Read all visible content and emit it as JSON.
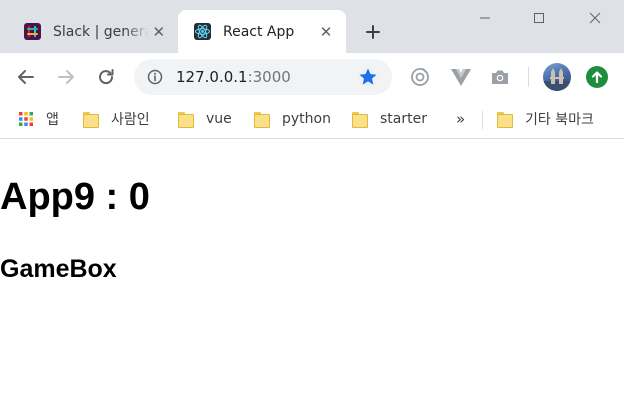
{
  "browser": {
    "tabs": [
      {
        "title": "Slack | general",
        "favicon": "slack-icon",
        "active": false
      },
      {
        "title": "React App",
        "favicon": "react-icon",
        "active": true
      }
    ],
    "tab_close_glyph": "✕",
    "omnibox": {
      "url_host": "127.0.0.1",
      "url_port": ":3000"
    },
    "bookmarks": [
      {
        "label": "앱",
        "icon": "apps-grid-icon"
      },
      {
        "label": "사람인",
        "icon": "folder-icon"
      },
      {
        "label": "vue",
        "icon": "folder-icon"
      },
      {
        "label": "python",
        "icon": "folder-icon"
      },
      {
        "label": "starter",
        "icon": "folder-icon"
      }
    ],
    "more_bookmarks_glyph": "»",
    "other_bookmarks": {
      "label": "기타 북마크",
      "icon": "folder-icon"
    },
    "colors": {
      "tab_strip": "#dee1e6",
      "star": "#1a73e8",
      "update": "#1e8e3e"
    }
  },
  "page": {
    "heading": "App9 : 0",
    "subheading": "GameBox"
  }
}
